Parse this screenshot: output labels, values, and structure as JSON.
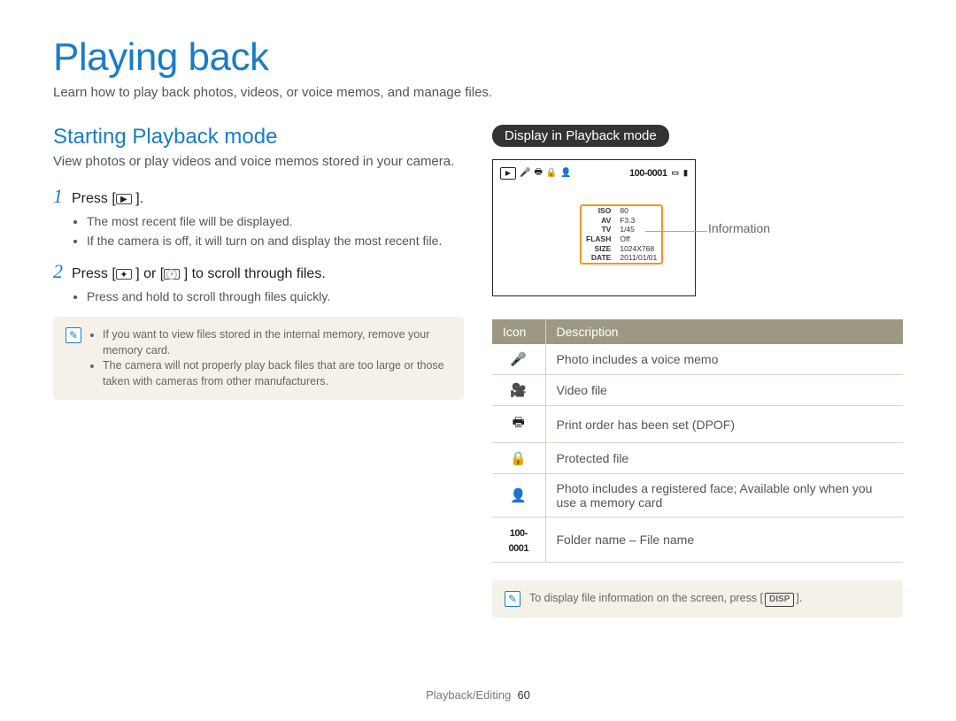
{
  "page": {
    "title": "Playing back",
    "intro": "Learn how to play back photos, videos, or voice memos, and manage files.",
    "section_title": "Starting Playback mode",
    "section_desc": "View photos or play videos and voice memos stored in your camera.",
    "steps": [
      {
        "num": "1",
        "text_pre": "Press [",
        "text_post": " ].",
        "bullets": [
          "The most recent file will be displayed.",
          "If the camera is off, it will turn on and display the most recent file."
        ]
      },
      {
        "num": "2",
        "text_pre": "Press [",
        "text_mid": " ] or [",
        "text_post": " ] to scroll through files.",
        "bullets": [
          "Press and hold to scroll through files quickly."
        ]
      }
    ],
    "note1": [
      "If you want to view files stored in the internal memory, remove your memory card.",
      "The camera will not properly play back files that are too large or those taken with cameras from other manufacturers."
    ],
    "right_header": "Display in Playback mode",
    "info_callout": "Information",
    "screen_top_file": "100-0001",
    "info_rows": [
      [
        "ISO",
        "80"
      ],
      [
        "AV",
        "F3.3"
      ],
      [
        "TV",
        "1/45"
      ],
      [
        "FLASH",
        "Off"
      ],
      [
        "SIZE",
        "1024X768"
      ],
      [
        "DATE",
        "2011/01/01"
      ]
    ],
    "table_headers": [
      "Icon",
      "Description"
    ],
    "icon_rows": [
      {
        "icon": "🎤",
        "desc": "Photo includes a voice memo"
      },
      {
        "icon": "🎥",
        "desc": "Video file"
      },
      {
        "icon": "🖶",
        "desc": "Print order has been set (DPOF)"
      },
      {
        "icon": "🔒",
        "desc": "Protected file"
      },
      {
        "icon": "👤",
        "desc": "Photo includes a registered face; Available only when you use a memory card"
      },
      {
        "icon_text": "100-0001",
        "desc": "Folder name – File name"
      }
    ],
    "note2_pre": "To display file information on the screen, press [",
    "note2_btn": "DISP",
    "note2_post": "].",
    "footer_section": "Playback/Editing",
    "footer_page": "60"
  }
}
